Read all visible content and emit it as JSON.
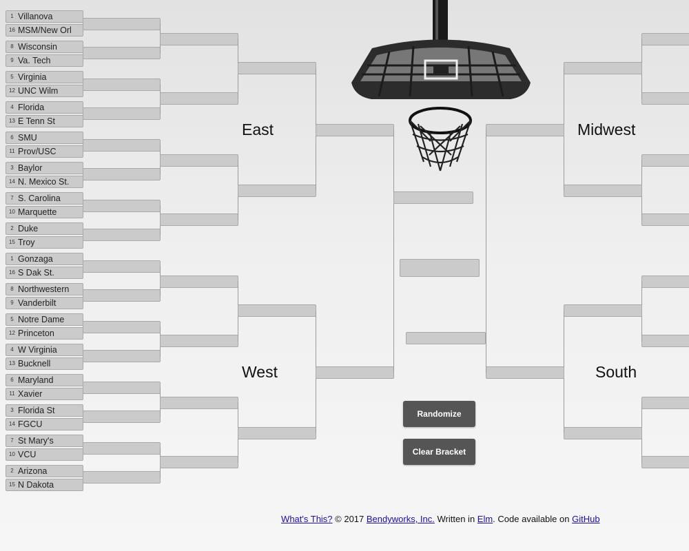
{
  "regions": {
    "east": "East",
    "west": "West",
    "midwest": "Midwest",
    "south": "South"
  },
  "east_teams": [
    {
      "seed": "1",
      "name": "Villanova"
    },
    {
      "seed": "16",
      "name": "MSM/New Orl"
    },
    {
      "seed": "8",
      "name": "Wisconsin"
    },
    {
      "seed": "9",
      "name": "Va. Tech"
    },
    {
      "seed": "5",
      "name": "Virginia"
    },
    {
      "seed": "12",
      "name": "UNC Wilm"
    },
    {
      "seed": "4",
      "name": "Florida"
    },
    {
      "seed": "13",
      "name": "E Tenn St"
    },
    {
      "seed": "6",
      "name": "SMU"
    },
    {
      "seed": "11",
      "name": "Prov/USC"
    },
    {
      "seed": "3",
      "name": "Baylor"
    },
    {
      "seed": "14",
      "name": "N. Mexico St."
    },
    {
      "seed": "7",
      "name": "S. Carolina"
    },
    {
      "seed": "10",
      "name": "Marquette"
    },
    {
      "seed": "2",
      "name": "Duke"
    },
    {
      "seed": "15",
      "name": "Troy"
    }
  ],
  "west_teams": [
    {
      "seed": "1",
      "name": "Gonzaga"
    },
    {
      "seed": "16",
      "name": "S Dak St."
    },
    {
      "seed": "8",
      "name": "Northwestern"
    },
    {
      "seed": "9",
      "name": "Vanderbilt"
    },
    {
      "seed": "5",
      "name": "Notre Dame"
    },
    {
      "seed": "12",
      "name": "Princeton"
    },
    {
      "seed": "4",
      "name": "W Virginia"
    },
    {
      "seed": "13",
      "name": "Bucknell"
    },
    {
      "seed": "6",
      "name": "Maryland"
    },
    {
      "seed": "11",
      "name": "Xavier"
    },
    {
      "seed": "3",
      "name": "Florida St"
    },
    {
      "seed": "14",
      "name": "FGCU"
    },
    {
      "seed": "7",
      "name": "St Mary's"
    },
    {
      "seed": "10",
      "name": "VCU"
    },
    {
      "seed": "2",
      "name": "Arizona"
    },
    {
      "seed": "15",
      "name": "N Dakota"
    }
  ],
  "buttons": {
    "randomize": "Randomize",
    "clear": "Clear Bracket"
  },
  "footer": {
    "whats_this": "What's This?",
    "copyright": " © 2017 ",
    "company": "Bendyworks, Inc.",
    "written_in": " Written in ",
    "elm": "Elm",
    "code_available": ". Code available on ",
    "github": "GitHub"
  },
  "colors": {
    "slot_fill": "#cbcbcb",
    "button_bg": "#555555",
    "link": "#1a0dab"
  }
}
